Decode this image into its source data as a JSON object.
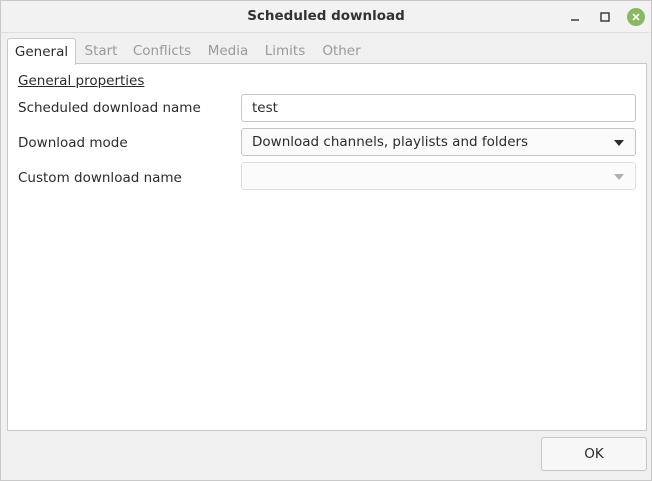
{
  "window": {
    "title": "Scheduled download"
  },
  "tabs": [
    {
      "label": "General",
      "active": true
    },
    {
      "label": "Start",
      "active": false
    },
    {
      "label": "Conflicts",
      "active": false
    },
    {
      "label": "Media",
      "active": false
    },
    {
      "label": "Limits",
      "active": false
    },
    {
      "label": "Other",
      "active": false
    }
  ],
  "general": {
    "section_title": "General properties",
    "name_label": "Scheduled download name",
    "name_value": "test",
    "mode_label": "Download mode",
    "mode_value": "Download channels, playlists and folders",
    "custom_label": "Custom download name",
    "custom_value": ""
  },
  "footer": {
    "ok_label": "OK"
  },
  "colors": {
    "close_button": "#8ab963"
  }
}
